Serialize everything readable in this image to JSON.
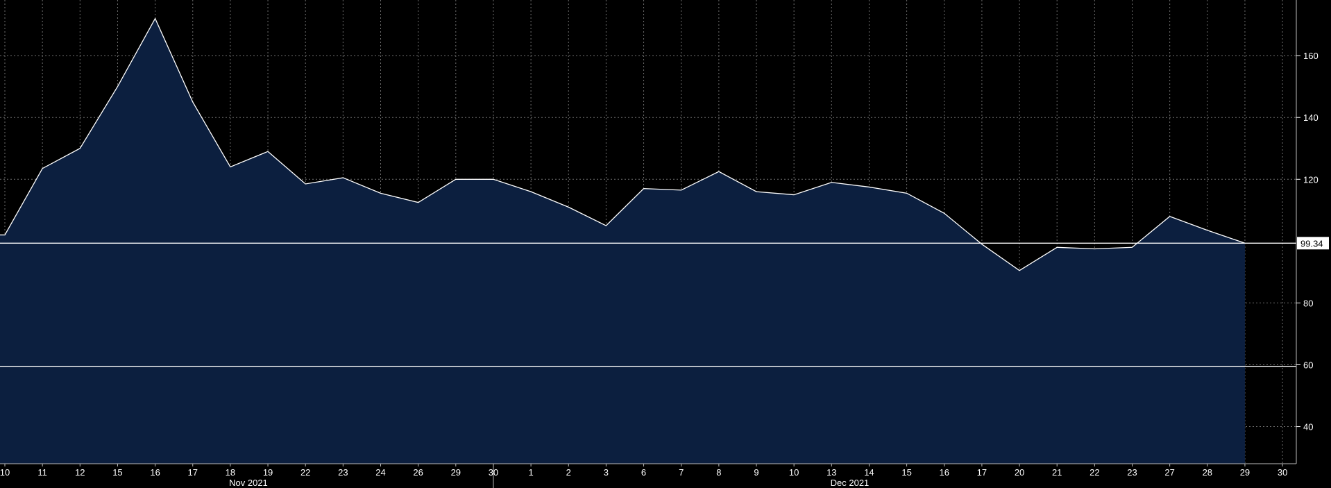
{
  "chart_data": {
    "type": "area",
    "x": [
      "10",
      "11",
      "12",
      "15",
      "16",
      "17",
      "18",
      "19",
      "22",
      "23",
      "24",
      "26",
      "29",
      "30",
      "1",
      "2",
      "3",
      "6",
      "7",
      "8",
      "9",
      "10",
      "13",
      "14",
      "15",
      "16",
      "17",
      "20",
      "21",
      "22",
      "23",
      "27",
      "28",
      "29"
    ],
    "series": [
      {
        "values": [
          102,
          123.5,
          130,
          150,
          172,
          145,
          124,
          129,
          118.5,
          120.5,
          115.5,
          112.5,
          120,
          120,
          116,
          111,
          105,
          117,
          116.5,
          122.5,
          116,
          115,
          119,
          117.5,
          115.5,
          109,
          99,
          90.5,
          98,
          97.5,
          98,
          108,
          103.5,
          99.34
        ]
      }
    ],
    "x_tick_labels": [
      "10",
      "11",
      "12",
      "15",
      "16",
      "17",
      "18",
      "19",
      "22",
      "23",
      "24",
      "26",
      "29",
      "30",
      "1",
      "2",
      "3",
      "6",
      "7",
      "8",
      "9",
      "10",
      "13",
      "14",
      "15",
      "16",
      "17",
      "20",
      "21",
      "22",
      "23",
      "27",
      "28",
      "29",
      "30"
    ],
    "month_labels": [
      "Nov 2021",
      "Dec 2021"
    ],
    "y_ticks": [
      40,
      60,
      80,
      120,
      140,
      160
    ],
    "ylim": [
      28,
      178
    ],
    "reference_lines": [
      99.34,
      59.5
    ],
    "last_value_label": "99.34",
    "grid": true,
    "colors": {
      "background": "#000000",
      "area_fill": "#0c1f3f",
      "line": "#ffffff",
      "grid": "#6f6f6f",
      "text": "#ffffff"
    }
  }
}
